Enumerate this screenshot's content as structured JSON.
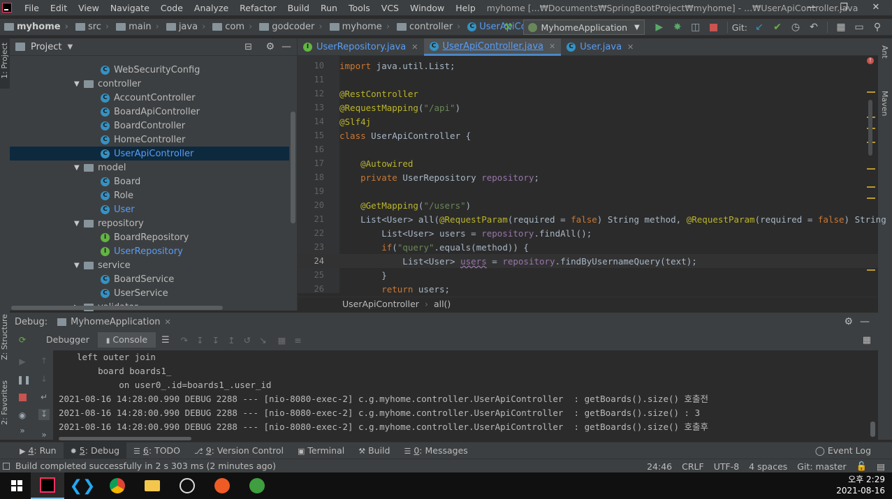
{
  "menu": {
    "items": [
      "File",
      "Edit",
      "View",
      "Navigate",
      "Code",
      "Analyze",
      "Refactor",
      "Build",
      "Run",
      "Tools",
      "VCS",
      "Window",
      "Help"
    ],
    "window_title": "myhome [...₩Documents₩SpringBootProject₩myhome] - ...₩UserApiController.java"
  },
  "breadcrumbs": [
    "myhome",
    "src",
    "main",
    "java",
    "com",
    "godcoder",
    "myhome",
    "controller",
    "UserApiController"
  ],
  "toolbar": {
    "run_config": "MyhomeApplication",
    "git_label": "Git:"
  },
  "project": {
    "header": "Project",
    "items": [
      {
        "label": "WebSecurityConfig",
        "kind": "class"
      },
      {
        "label": "controller",
        "kind": "folder"
      },
      {
        "label": "AccountController",
        "kind": "class"
      },
      {
        "label": "BoardApiController",
        "kind": "class"
      },
      {
        "label": "BoardController",
        "kind": "class"
      },
      {
        "label": "HomeController",
        "kind": "class"
      },
      {
        "label": "UserApiController",
        "kind": "class-selected"
      },
      {
        "label": "model",
        "kind": "folder"
      },
      {
        "label": "Board",
        "kind": "class"
      },
      {
        "label": "Role",
        "kind": "class"
      },
      {
        "label": "User",
        "kind": "class-modified"
      },
      {
        "label": "repository",
        "kind": "folder"
      },
      {
        "label": "BoardRepository",
        "kind": "interface"
      },
      {
        "label": "UserRepository",
        "kind": "interface-modified"
      },
      {
        "label": "service",
        "kind": "folder"
      },
      {
        "label": "BoardService",
        "kind": "class"
      },
      {
        "label": "UserService",
        "kind": "class"
      },
      {
        "label": "validator",
        "kind": "folder-collapsed"
      }
    ]
  },
  "editor": {
    "tabs": [
      {
        "label": "UserRepository.java",
        "icon": "interface"
      },
      {
        "label": "UserApiController.java",
        "icon": "class",
        "active": true
      },
      {
        "label": "User.java",
        "icon": "class"
      }
    ],
    "line_numbers": [
      "10",
      "11",
      "12",
      "13",
      "14",
      "15",
      "16",
      "17",
      "18",
      "19",
      "20",
      "21",
      "22",
      "23",
      "24",
      "25",
      "26"
    ],
    "current_line": "24",
    "breadcrumb": [
      "UserApiController",
      "all()"
    ]
  },
  "debug": {
    "title": "Debug:",
    "session": "MyhomeApplication",
    "tabs": [
      "Debugger",
      "Console"
    ],
    "console_lines": [
      "left outer join",
      "    board boards1_",
      "        on user0_.id=boards1_.user_id",
      "2021-08-16 14:28:00.990 DEBUG 2288 --- [nio-8080-exec-2] c.g.myhome.controller.UserApiController  : getBoards().size() 호출전",
      "2021-08-16 14:28:00.990 DEBUG 2288 --- [nio-8080-exec-2] c.g.myhome.controller.UserApiController  : getBoards().size() : 3",
      "2021-08-16 14:28:00.990 DEBUG 2288 --- [nio-8080-exec-2] c.g.myhome.controller.UserApiController  : getBoards().size() 호출후"
    ]
  },
  "tool_tabs": [
    {
      "num": "4",
      "label": "Run"
    },
    {
      "num": "5",
      "label": "Debug",
      "active": true
    },
    {
      "num": "6",
      "label": "TODO"
    },
    {
      "num": "9",
      "label": "Version Control"
    },
    {
      "num": "",
      "label": "Terminal"
    },
    {
      "num": "",
      "label": "Build"
    },
    {
      "num": "0",
      "label": "Messages"
    }
  ],
  "event_log": "Event Log",
  "status": {
    "message": "Build completed successfully in 2 s 303 ms (2 minutes ago)",
    "position": "24:46",
    "line_sep": "CRLF",
    "encoding": "UTF-8",
    "indent": "4 spaces",
    "branch": "Git: master"
  },
  "side_tabs": {
    "project": "1: Project",
    "structure": "Z: Structure",
    "favorites": "2: Favorites",
    "ant": "Ant",
    "maven": "Maven"
  },
  "clock": {
    "time": "오후 2:29",
    "date": "2021-08-16"
  },
  "colors": {
    "accent": "#589df6",
    "selection": "#0d293e",
    "keyword": "#cc7832",
    "annotation": "#bbb529"
  }
}
